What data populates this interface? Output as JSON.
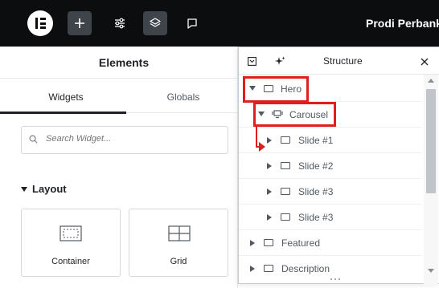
{
  "topbar": {
    "logo_icon": "elementor-logo-icon",
    "buttons": [
      {
        "name": "add-element-button",
        "icon": "plus-icon"
      },
      {
        "name": "site-settings-button",
        "icon": "sliders-icon"
      },
      {
        "name": "structure-button",
        "icon": "layers-icon"
      },
      {
        "name": "notes-button",
        "icon": "comment-icon"
      }
    ],
    "document_title": "Prodi Perbank"
  },
  "elements_panel": {
    "title": "Elements",
    "tabs": [
      {
        "label": "Widgets",
        "active": true
      },
      {
        "label": "Globals",
        "active": false
      }
    ],
    "search": {
      "placeholder": "Search Widget...",
      "value": ""
    },
    "section": "Layout",
    "widgets": [
      {
        "label": "Container",
        "icon": "container-icon"
      },
      {
        "label": "Grid",
        "icon": "grid-icon"
      }
    ]
  },
  "structure_panel": {
    "title": "Structure",
    "rows": [
      {
        "label": "Hero",
        "expanded": true,
        "level": 0,
        "highlighted": true
      },
      {
        "label": "Carousel",
        "expanded": true,
        "level": 1,
        "highlighted": true
      },
      {
        "label": "Slide #1",
        "expanded": false,
        "level": 2
      },
      {
        "label": "Slide #2",
        "expanded": false,
        "level": 2
      },
      {
        "label": "Slide #3",
        "expanded": false,
        "level": 2
      },
      {
        "label": "Slide #3",
        "expanded": false,
        "level": 2
      },
      {
        "label": "Featured",
        "expanded": false,
        "level": 0
      },
      {
        "label": "Description",
        "expanded": false,
        "level": 0
      }
    ]
  },
  "colors": {
    "topbar_bg": "#0c0d0e",
    "highlight": "#e01e1e",
    "active_button_bg": "#3f444b"
  }
}
